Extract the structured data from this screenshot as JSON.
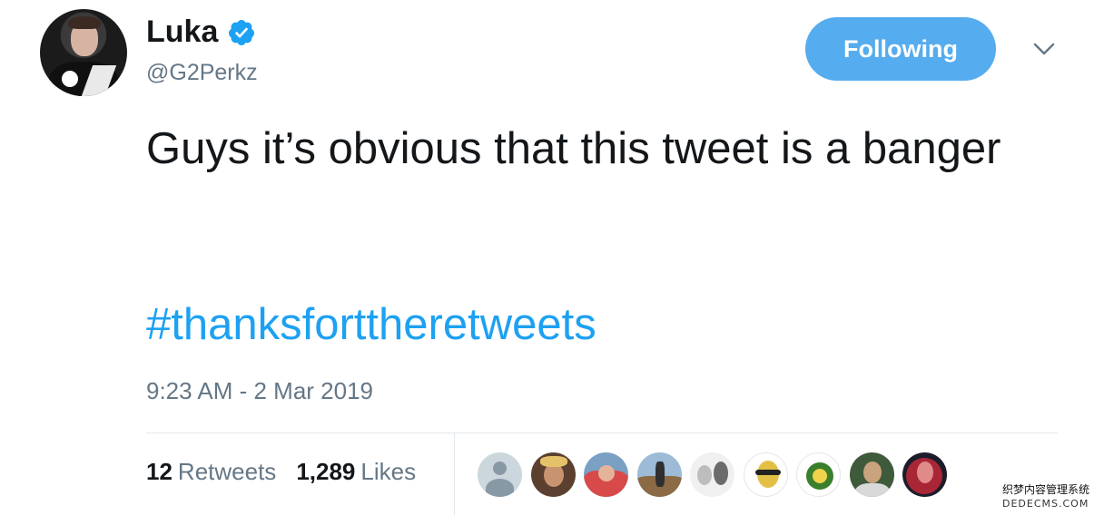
{
  "profile": {
    "name": "Luka",
    "handle": "@G2Perkz",
    "verified": true,
    "avatar_icon": "profile-photo"
  },
  "actions": {
    "follow_label": "Following",
    "menu_icon": "chevron-down-icon"
  },
  "tweet": {
    "text": "Guys it’s obvious that this tweet is a banger",
    "hashtag": "#thanksforttheretweets",
    "timestamp": "9:23 AM - 2 Mar 2019"
  },
  "stats": {
    "retweets_count": "12",
    "retweets_label": "Retweets",
    "likes_count": "1,289",
    "likes_label": "Likes"
  },
  "liker_avatars_count": 9,
  "watermark": {
    "line1": "织梦内容管理系统",
    "line2": "DEDECMS.COM"
  },
  "colors": {
    "accent": "#1da1f2",
    "follow_button": "#55acee",
    "secondary_text": "#657786",
    "primary_text": "#14171a",
    "divider": "#e1e8ed"
  }
}
